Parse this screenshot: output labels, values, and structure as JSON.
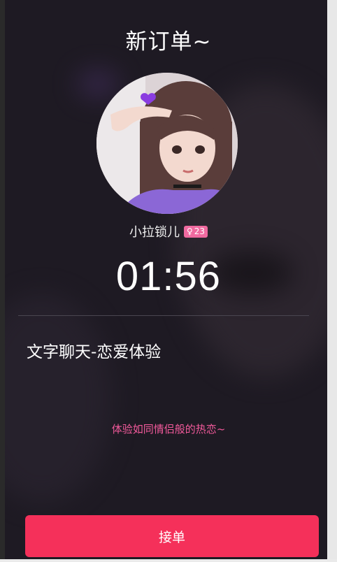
{
  "header": {
    "title": "新订单~"
  },
  "user": {
    "nickname": "小拉锁儿",
    "gender_symbol": "♀",
    "age": "23",
    "badge_color": "#f06aa0"
  },
  "order": {
    "countdown": "01:56",
    "service": "文字聊天-恋爱体验",
    "tagline": "体验如同情侣般的热恋~"
  },
  "actions": {
    "accept_label": "接单"
  },
  "colors": {
    "accent": "#f5305a",
    "tagline": "#f25a9b",
    "background": "#1e1a23"
  }
}
